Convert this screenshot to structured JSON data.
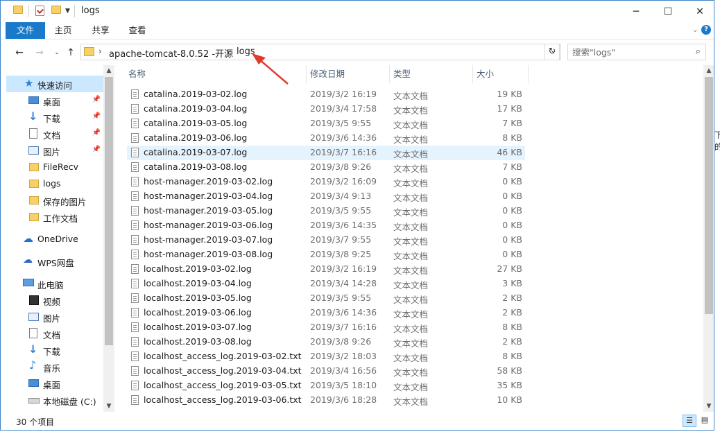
{
  "window": {
    "title": "logs"
  },
  "ribbon": {
    "tabs": [
      "文件",
      "主页",
      "共享",
      "查看"
    ]
  },
  "address": {
    "crumbs": [
      "apache-tomcat-8.0.52 -开源",
      "logs"
    ]
  },
  "search": {
    "placeholder": "搜索\"logs\""
  },
  "columns": [
    "名称",
    "修改日期",
    "类型",
    "大小"
  ],
  "nav": {
    "items": [
      {
        "label": "快速访问",
        "icon": "star-icon",
        "pinned": false,
        "selected": true
      },
      {
        "label": "桌面",
        "icon": "desktop-icon",
        "pinned": true
      },
      {
        "label": "下载",
        "icon": "download-icon",
        "pinned": true
      },
      {
        "label": "文档",
        "icon": "document-icon",
        "pinned": true
      },
      {
        "label": "图片",
        "icon": "picture-icon",
        "pinned": true
      },
      {
        "label": "FileRecv",
        "icon": "folder-icon"
      },
      {
        "label": "logs",
        "icon": "folder-icon"
      },
      {
        "label": "保存的图片",
        "icon": "folder-icon"
      },
      {
        "label": "工作文档",
        "icon": "folder-icon"
      },
      {
        "label": "OneDrive",
        "icon": "cloud-icon"
      },
      {
        "label": "WPS网盘",
        "icon": "wps-cloud-icon"
      },
      {
        "label": "此电脑",
        "icon": "computer-icon"
      },
      {
        "label": "视频",
        "icon": "video-icon"
      },
      {
        "label": "图片",
        "icon": "picture-icon"
      },
      {
        "label": "文档",
        "icon": "document-icon"
      },
      {
        "label": "下载",
        "icon": "download-icon"
      },
      {
        "label": "音乐",
        "icon": "music-icon"
      },
      {
        "label": "桌面",
        "icon": "desktop-icon"
      },
      {
        "label": "本地磁盘 (C:)",
        "icon": "disk-icon"
      }
    ]
  },
  "files": [
    {
      "name": "catalina.2019-03-02.log",
      "date": "2019/3/2 16:19",
      "type": "文本文档",
      "size": "19 KB"
    },
    {
      "name": "catalina.2019-03-04.log",
      "date": "2019/3/4 17:58",
      "type": "文本文档",
      "size": "17 KB"
    },
    {
      "name": "catalina.2019-03-05.log",
      "date": "2019/3/5 9:55",
      "type": "文本文档",
      "size": "7 KB"
    },
    {
      "name": "catalina.2019-03-06.log",
      "date": "2019/3/6 14:36",
      "type": "文本文档",
      "size": "8 KB"
    },
    {
      "name": "catalina.2019-03-07.log",
      "date": "2019/3/7 16:16",
      "type": "文本文档",
      "size": "46 KB",
      "highlighted": true
    },
    {
      "name": "catalina.2019-03-08.log",
      "date": "2019/3/8 9:26",
      "type": "文本文档",
      "size": "7 KB"
    },
    {
      "name": "host-manager.2019-03-02.log",
      "date": "2019/3/2 16:09",
      "type": "文本文档",
      "size": "0 KB"
    },
    {
      "name": "host-manager.2019-03-04.log",
      "date": "2019/3/4 9:13",
      "type": "文本文档",
      "size": "0 KB"
    },
    {
      "name": "host-manager.2019-03-05.log",
      "date": "2019/3/5 9:55",
      "type": "文本文档",
      "size": "0 KB"
    },
    {
      "name": "host-manager.2019-03-06.log",
      "date": "2019/3/6 14:35",
      "type": "文本文档",
      "size": "0 KB"
    },
    {
      "name": "host-manager.2019-03-07.log",
      "date": "2019/3/7 9:55",
      "type": "文本文档",
      "size": "0 KB"
    },
    {
      "name": "host-manager.2019-03-08.log",
      "date": "2019/3/8 9:25",
      "type": "文本文档",
      "size": "0 KB"
    },
    {
      "name": "localhost.2019-03-02.log",
      "date": "2019/3/2 16:19",
      "type": "文本文档",
      "size": "27 KB"
    },
    {
      "name": "localhost.2019-03-04.log",
      "date": "2019/3/4 14:28",
      "type": "文本文档",
      "size": "3 KB"
    },
    {
      "name": "localhost.2019-03-05.log",
      "date": "2019/3/5 9:55",
      "type": "文本文档",
      "size": "2 KB"
    },
    {
      "name": "localhost.2019-03-06.log",
      "date": "2019/3/6 14:36",
      "type": "文本文档",
      "size": "2 KB"
    },
    {
      "name": "localhost.2019-03-07.log",
      "date": "2019/3/7 16:16",
      "type": "文本文档",
      "size": "8 KB"
    },
    {
      "name": "localhost.2019-03-08.log",
      "date": "2019/3/8 9:26",
      "type": "文本文档",
      "size": "2 KB"
    },
    {
      "name": "localhost_access_log.2019-03-02.txt",
      "date": "2019/3/2 18:03",
      "type": "文本文档",
      "size": "8 KB"
    },
    {
      "name": "localhost_access_log.2019-03-04.txt",
      "date": "2019/3/4 16:56",
      "type": "文本文档",
      "size": "58 KB"
    },
    {
      "name": "localhost_access_log.2019-03-05.txt",
      "date": "2019/3/5 18:10",
      "type": "文本文档",
      "size": "35 KB"
    },
    {
      "name": "localhost_access_log.2019-03-06.txt",
      "date": "2019/3/6 18:28",
      "type": "文本文档",
      "size": "10 KB"
    }
  ],
  "status": {
    "count": "30 个项目"
  },
  "background": {
    "stub": "下的"
  },
  "colors": {
    "accent": "#1979ca",
    "selection": "#cce8ff",
    "hover_row": "#e5f3ff",
    "annotation_arrow": "#e03a2f"
  }
}
